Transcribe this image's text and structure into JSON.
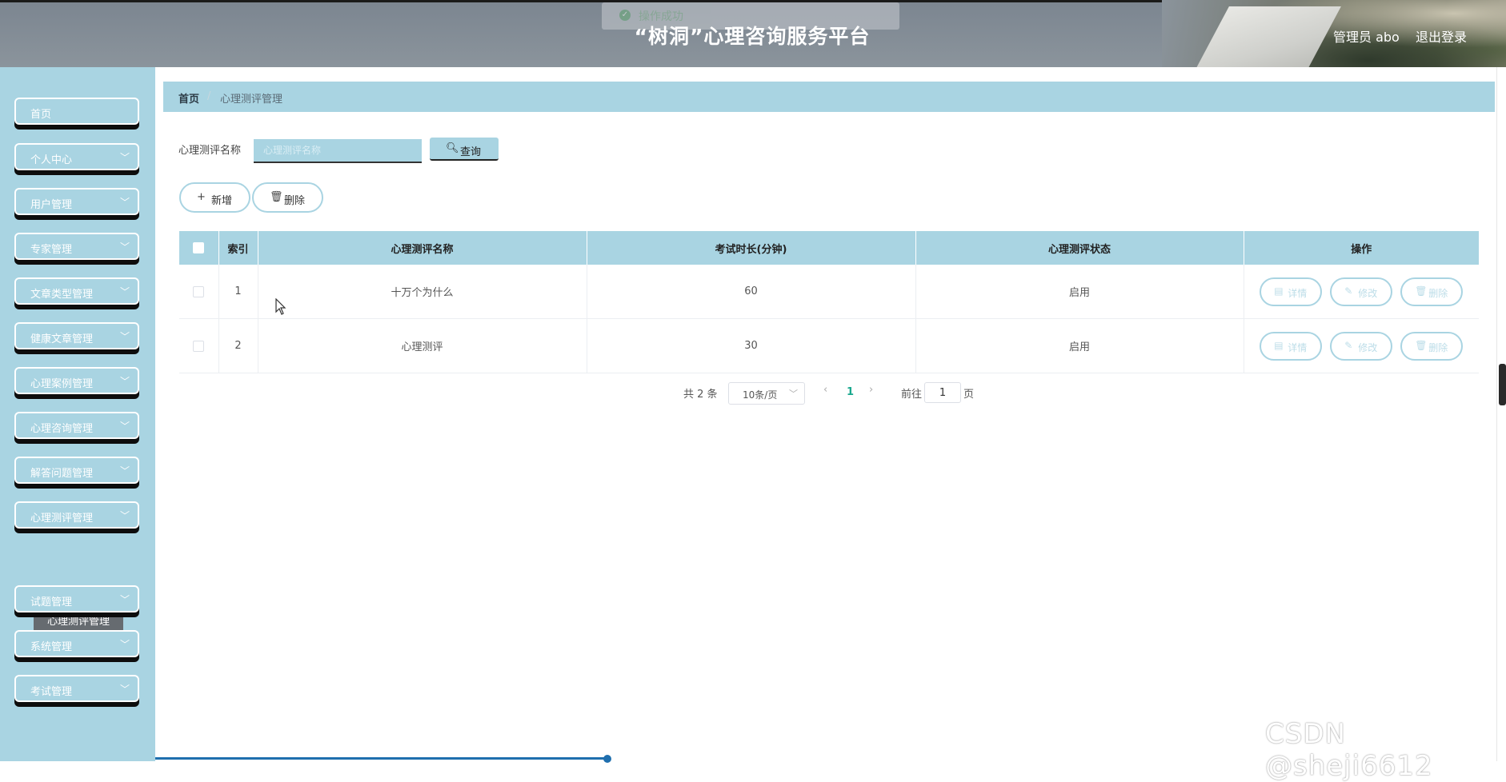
{
  "header": {
    "title": "“树洞”心理咨询服务平台",
    "user": "管理员 abo",
    "logout": "退出登录",
    "toast": "操作成功"
  },
  "sidebar": {
    "items": [
      {
        "label": "首页",
        "chevron": false
      },
      {
        "label": "个人中心",
        "chevron": true
      },
      {
        "label": "用户管理",
        "chevron": true
      },
      {
        "label": "专家管理",
        "chevron": true
      },
      {
        "label": "文章类型管理",
        "chevron": true
      },
      {
        "label": "健康文章管理",
        "chevron": true
      },
      {
        "label": "心理案例管理",
        "chevron": true
      },
      {
        "label": "心理咨询管理",
        "chevron": true
      },
      {
        "label": "解答问题管理",
        "chevron": true
      },
      {
        "label": "心理测评管理",
        "chevron": true
      },
      {
        "label": "试题管理",
        "chevron": true
      },
      {
        "label": "系统管理",
        "chevron": true
      },
      {
        "label": "考试管理",
        "chevron": true
      }
    ],
    "submenu": {
      "label": "心理测评管理"
    }
  },
  "breadcrumb": {
    "home": "首页",
    "separator": "/",
    "current": "心理测评管理"
  },
  "search": {
    "label": "心理测评名称",
    "placeholder": "心理测评名称",
    "button": "查询"
  },
  "actions": {
    "add": "新增",
    "delete": "删除"
  },
  "table": {
    "columns": [
      "索引",
      "心理测评名称",
      "考试时长(分钟)",
      "心理测评状态",
      "操作"
    ],
    "rows": [
      {
        "index": "1",
        "name": "十万个为什么",
        "duration": "60",
        "status": "启用"
      },
      {
        "index": "2",
        "name": "心理测评",
        "duration": "30",
        "status": "启用"
      }
    ],
    "row_actions": {
      "detail": "详情",
      "edit": "修改",
      "delete": "删除"
    }
  },
  "pagination": {
    "total": "共 2 条",
    "page_size": "10条/页",
    "current_page": "1",
    "goto_label": "前往",
    "goto_value": "1",
    "page_unit": "页"
  },
  "watermark": "CSDN @sheji6612",
  "colors": {
    "accent": "#a9d4e2",
    "header_bg": "#838c94",
    "active_page": "#1aa88e",
    "submenu_bg": "#666b70"
  },
  "icons": {
    "search": "search-icon",
    "add": "plus-icon",
    "delete": "trash-icon",
    "detail": "document-icon",
    "edit": "pencil-icon",
    "expand": "chevron-down-icon"
  }
}
